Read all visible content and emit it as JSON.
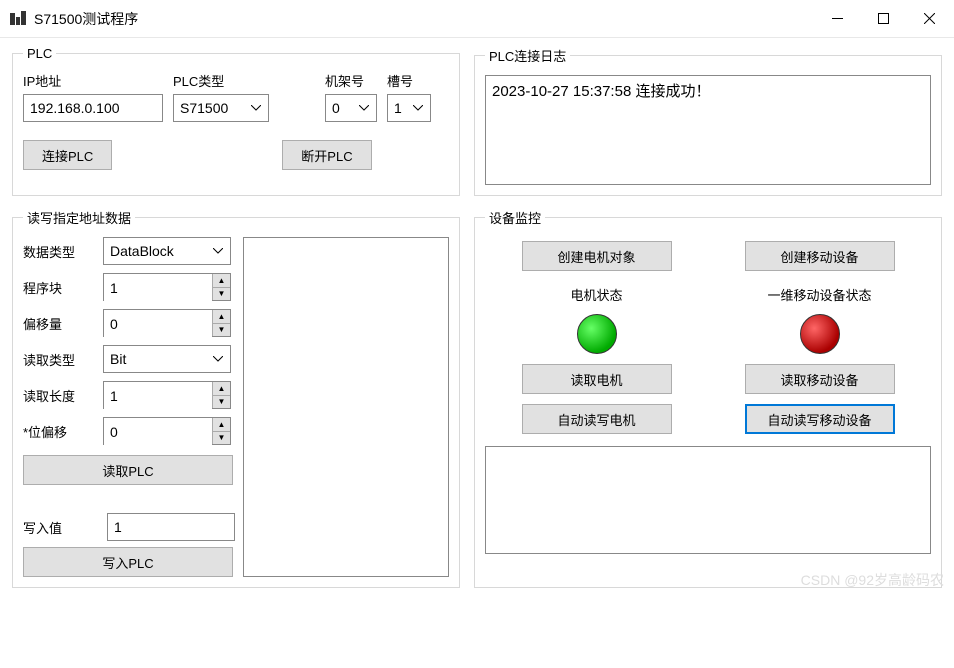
{
  "window": {
    "title": "S71500测试程序"
  },
  "plc": {
    "legend": "PLC",
    "ip_label": "IP地址",
    "ip_value": "192.168.0.100",
    "type_label": "PLC类型",
    "type_value": "S71500",
    "rack_label": "机架号",
    "rack_value": "0",
    "slot_label": "槽号",
    "slot_value": "1",
    "connect_label": "连接PLC",
    "disconnect_label": "断开PLC"
  },
  "log": {
    "legend": "PLC连接日志",
    "content": "2023-10-27 15:37:58  连接成功！"
  },
  "rw": {
    "legend": "读写指定地址数据",
    "datatype_label": "数据类型",
    "datatype_value": "DataBlock",
    "block_label": "程序块",
    "block_value": "1",
    "offset_label": "偏移量",
    "offset_value": "0",
    "readtype_label": "读取类型",
    "readtype_value": "Bit",
    "readlen_label": "读取长度",
    "readlen_value": "1",
    "bitoffset_label": "*位偏移",
    "bitoffset_value": "0",
    "read_label": "读取PLC",
    "writeval_label": "写入值",
    "writeval_value": "1",
    "write_label": "写入PLC"
  },
  "mon": {
    "legend": "设备监控",
    "create_motor_label": "创建电机对象",
    "create_mobile_label": "创建移动设备",
    "motor_status_label": "电机状态",
    "mobile_status_label": "一维移动设备状态",
    "read_motor_label": "读取电机",
    "read_mobile_label": "读取移动设备",
    "auto_motor_label": "自动读写电机",
    "auto_mobile_label": "自动读写移动设备"
  },
  "watermark": "CSDN @92岁高龄码农"
}
